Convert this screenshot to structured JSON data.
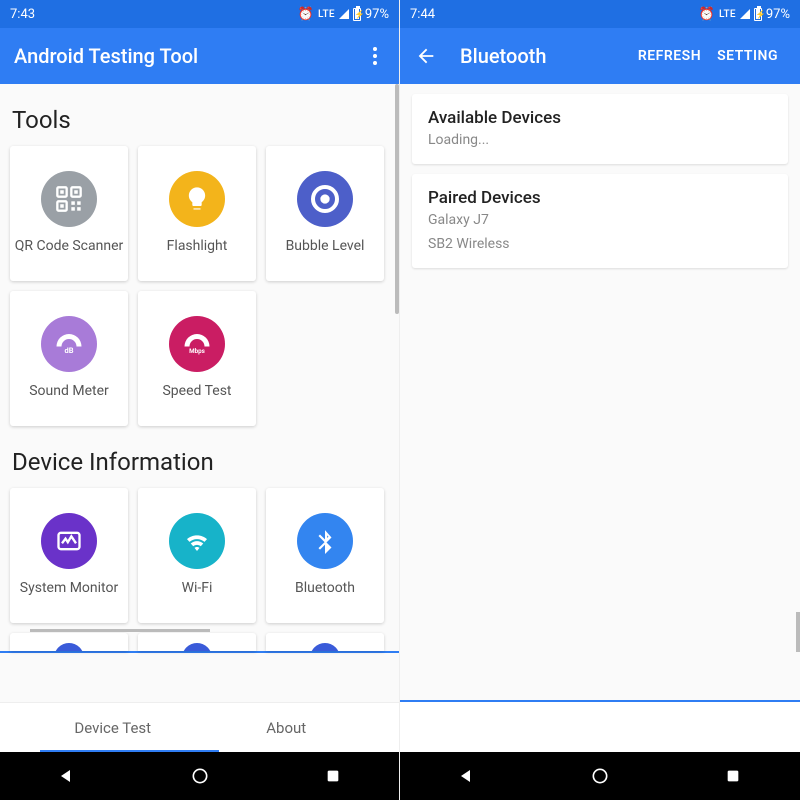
{
  "left": {
    "status": {
      "time": "7:43",
      "lte": "LTE",
      "battery": "97%"
    },
    "app_title": "Android Testing Tool",
    "sections": {
      "tools": {
        "title": "Tools",
        "items": [
          {
            "label": "QR Code Scanner"
          },
          {
            "label": "Flashlight"
          },
          {
            "label": "Bubble Level"
          },
          {
            "label": "Sound Meter"
          },
          {
            "label": "Speed Test"
          }
        ]
      },
      "device_info": {
        "title": "Device Information",
        "items": [
          {
            "label": "System Monitor"
          },
          {
            "label": "Wi-Fi"
          },
          {
            "label": "Bluetooth"
          }
        ]
      }
    },
    "tabs": {
      "device_test": "Device Test",
      "about": "About"
    }
  },
  "right": {
    "status": {
      "time": "7:44",
      "lte": "LTE",
      "battery": "97%"
    },
    "app_title": "Bluetooth",
    "actions": {
      "refresh": "REFRESH",
      "setting": "SETTING"
    },
    "available": {
      "title": "Available Devices",
      "status": "Loading..."
    },
    "paired": {
      "title": "Paired Devices",
      "items": [
        "Galaxy J7",
        "SB2 Wireless"
      ]
    }
  }
}
